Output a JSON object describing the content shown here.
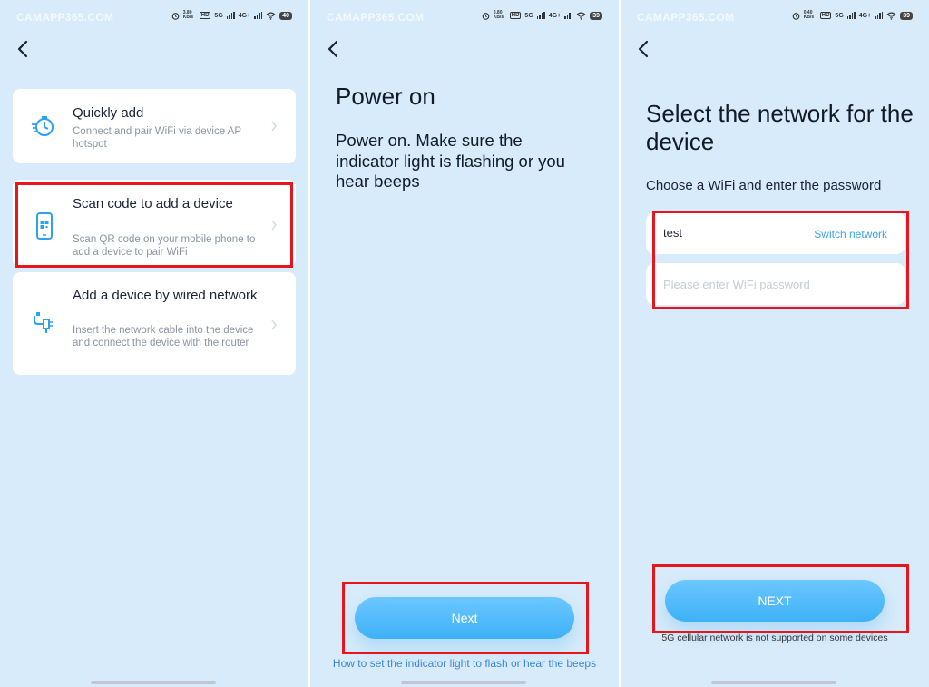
{
  "watermark": "CAMAPP365.COM",
  "colors": {
    "background": "#d7ebfa",
    "accent": "#3eb1f7",
    "highlight_box": "#e5161d",
    "link": "#3a86d6"
  },
  "screens": [
    {
      "status": {
        "speed": "3.80 KB/s",
        "hd": "HD",
        "net": "5G",
        "net2": "4G+",
        "battery": "40"
      },
      "back_icon": "chevron-left-icon",
      "options": [
        {
          "icon": "stopwatch-icon",
          "title": "Quickly add",
          "desc": "Connect and pair WiFi via device AP hotspot"
        },
        {
          "icon": "qr-phone-icon",
          "title": "Scan code to add a device",
          "desc": "Scan QR code on your mobile phone to add a device to pair WiFi"
        },
        {
          "icon": "ethernet-plug-icon",
          "title": "Add a device by wired network",
          "desc": "Insert the network cable into the device and connect the device with the router"
        }
      ]
    },
    {
      "status": {
        "speed": "0.80 KB/s",
        "hd": "HD",
        "net": "5G",
        "net2": "4G+",
        "battery": "39"
      },
      "back_icon": "chevron-left-icon",
      "title": "Power on",
      "instruction": "Power on. Make sure the indicator light is flashing or you hear beeps",
      "next_label": "Next",
      "help_link": "How to set the indicator light to flash or hear the beeps"
    },
    {
      "status": {
        "speed": "0.40 KB/s",
        "hd": "HD",
        "net": "5G",
        "net2": "4G+",
        "battery": "39"
      },
      "back_icon": "chevron-left-icon",
      "title": "Select the network for the device",
      "subtitle": "Choose a WiFi and enter the password",
      "ssid_value": "test",
      "switch_network_label": "Switch network",
      "password_placeholder": "Please enter WiFi password",
      "next_label": "NEXT",
      "footnote": "5G cellular network is not supported on some devices"
    }
  ]
}
